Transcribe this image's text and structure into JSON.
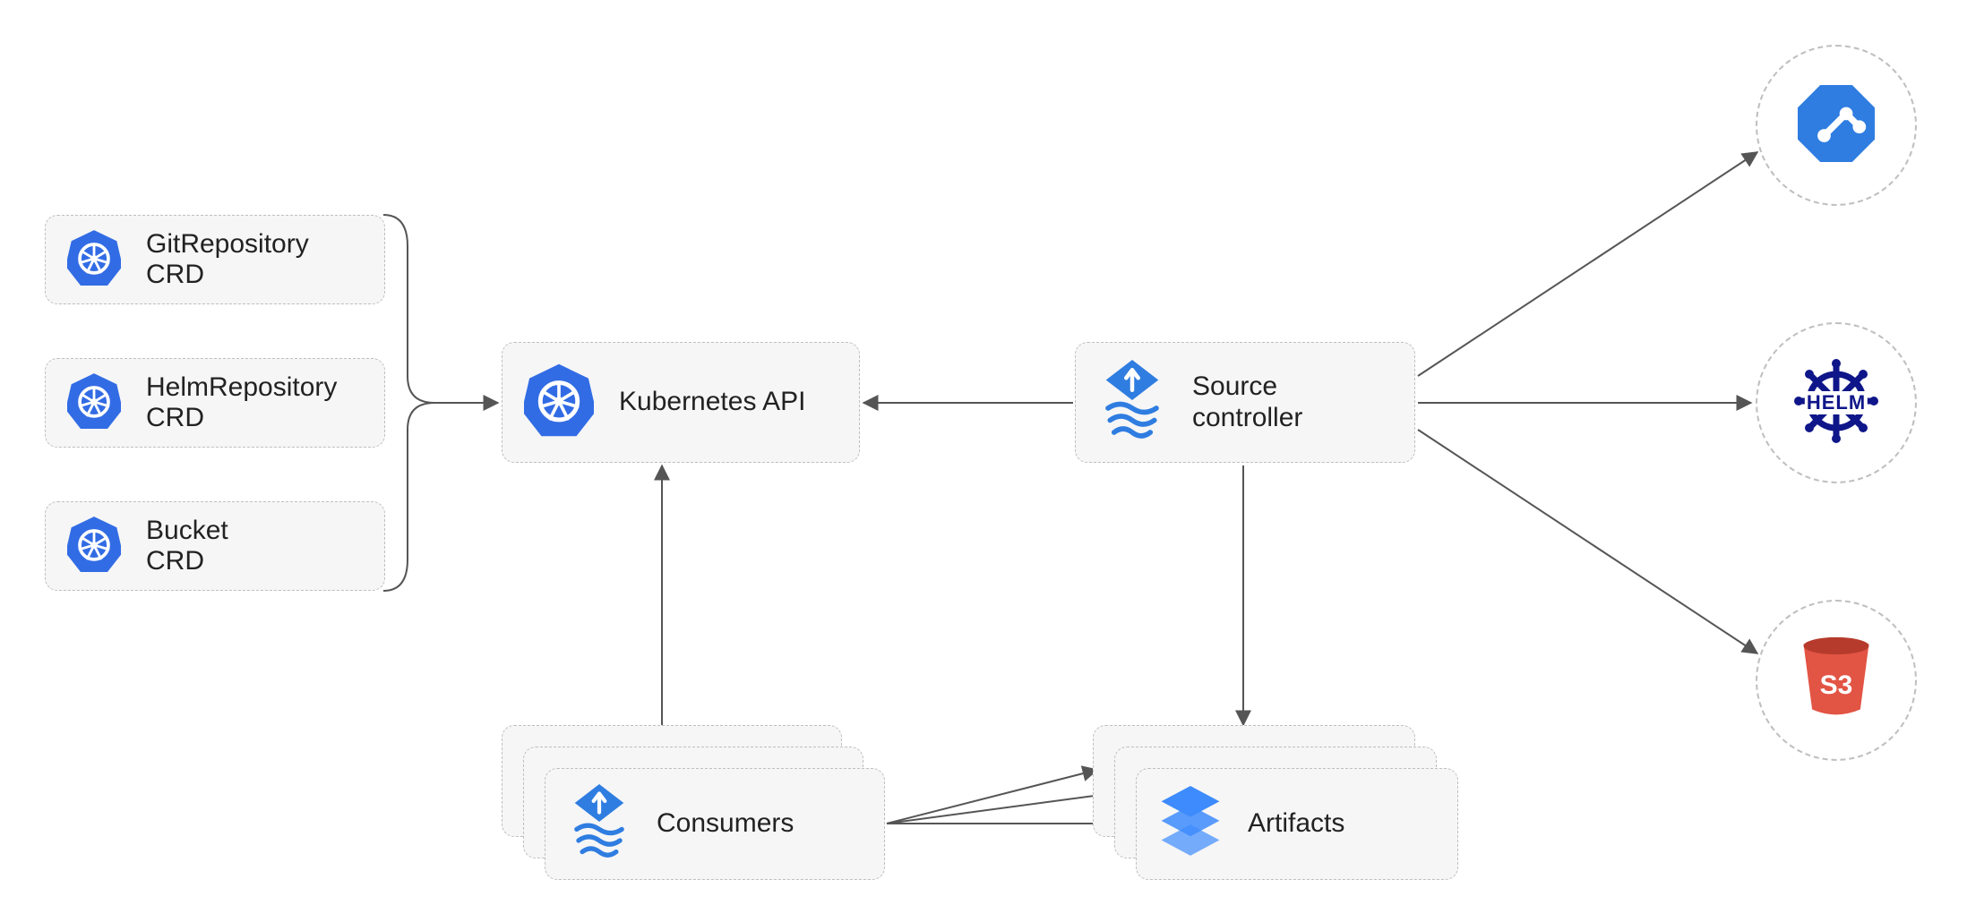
{
  "crd": {
    "git": {
      "line1": "GitRepository",
      "line2": "CRD"
    },
    "helm": {
      "line1": "HelmRepository",
      "line2": "CRD"
    },
    "bucket": {
      "line1": "Bucket",
      "line2": "CRD"
    }
  },
  "k8sapi": {
    "label": "Kubernetes API"
  },
  "source": {
    "line1": "Source",
    "line2": "controller"
  },
  "consumers": {
    "label": "Consumers"
  },
  "artifacts": {
    "label": "Artifacts"
  },
  "ext": {
    "git": {
      "name": "git"
    },
    "helm": {
      "name": "HELM"
    },
    "s3": {
      "name": "S3"
    }
  },
  "colors": {
    "k8sBlue": "#326ce5",
    "fluxBlue": "#3d7ddd",
    "helmNavy": "#0f1689",
    "s3Orange": "#e25444",
    "s3TextWhite": "#ffffff",
    "arrowGray": "#555555"
  }
}
